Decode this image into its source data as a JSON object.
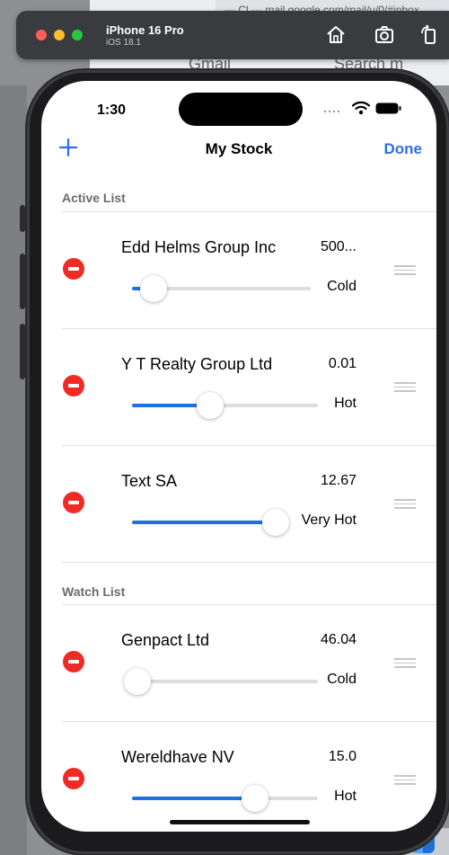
{
  "background": {
    "tab_text": "— Cl  ···  mail.google.com/mail/u/0/#inbox",
    "gmail_label": "Gmail",
    "search_label": "Search m"
  },
  "simulator": {
    "device_name": "iPhone 16 Pro",
    "os_version": "iOS 18.1",
    "icons": [
      "home-icon",
      "screenshot-icon",
      "rotate-icon"
    ]
  },
  "status_bar": {
    "time": "1:30"
  },
  "nav": {
    "add_icon": "plus-icon",
    "title": "My Stock",
    "done_label": "Done"
  },
  "colors": {
    "accent": "#2f6fe4",
    "delete": "#f02a25",
    "slider_fill": "#1f6fe5"
  },
  "sections": [
    {
      "header": "Active List",
      "items": [
        {
          "name": "Edd Helms Group Inc",
          "value": "500...",
          "heat": "Cold",
          "slider": 0.12
        },
        {
          "name": "Y T Realty Group Ltd",
          "value": "0.01",
          "heat": "Hot",
          "slider": 0.42
        },
        {
          "name": "Text SA",
          "value": "12.67",
          "heat": "Very Hot",
          "slider": 0.92
        }
      ]
    },
    {
      "header": "Watch List",
      "items": [
        {
          "name": "Genpact Ltd",
          "value": "46.04",
          "heat": "Cold",
          "slider": 0.03
        },
        {
          "name": "Wereldhave NV",
          "value": "15.0",
          "heat": "Hot",
          "slider": 0.66
        }
      ]
    }
  ]
}
